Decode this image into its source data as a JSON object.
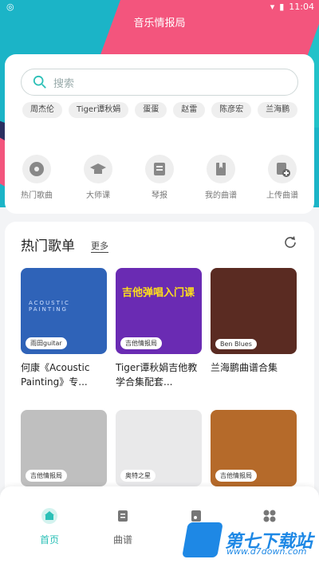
{
  "status": {
    "time": "11:04"
  },
  "title": "音乐情报局",
  "search": {
    "placeholder": "搜索"
  },
  "tags": [
    "周杰伦",
    "Tiger谭秋娟",
    "蛋蛋",
    "赵雷",
    "陈彦宏",
    "兰海鹏"
  ],
  "quick": [
    {
      "label": "热门歌曲",
      "icon": "disc-icon"
    },
    {
      "label": "大师课",
      "icon": "graduation-cap-icon"
    },
    {
      "label": "琴报",
      "icon": "news-icon"
    },
    {
      "label": "我的曲谱",
      "icon": "bookmark-icon"
    },
    {
      "label": "上传曲谱",
      "icon": "upload-score-icon"
    }
  ],
  "hot": {
    "title": "热门歌单",
    "more": "更多",
    "cards": [
      {
        "badge": "雨田guitar",
        "title": "何康《Acoustic Painting》专...",
        "color": "#2f63b8",
        "cover_text": "ACOUSTIC PAINTING"
      },
      {
        "badge": "吉他情报局",
        "title": "Tiger谭秋娟吉他教学合集配套...",
        "color": "#6a2bb3",
        "cover_text": "吉他弹唱入门课"
      },
      {
        "badge": "Ben Blues",
        "title": "兰海鹏曲谱合集",
        "color": "#5a2b22",
        "cover_text": ""
      },
      {
        "badge": "吉他情报局",
        "title": "",
        "color": "#bfbfbf",
        "cover_text": ""
      },
      {
        "badge": "奥特之星",
        "title": "",
        "color": "#e9e9ea",
        "cover_text": ""
      },
      {
        "badge": "吉他情报局",
        "title": "",
        "color": "#b56a2a",
        "cover_text": ""
      }
    ]
  },
  "tabs": [
    {
      "label": "首页",
      "icon": "home-icon",
      "active": true
    },
    {
      "label": "曲谱",
      "icon": "score-icon",
      "active": false
    },
    {
      "label": "",
      "icon": "music-icon",
      "active": false
    },
    {
      "label": "",
      "icon": "grid-icon",
      "active": false
    }
  ],
  "watermark": {
    "text": "第七下载站",
    "url": "www.d7down.com"
  }
}
